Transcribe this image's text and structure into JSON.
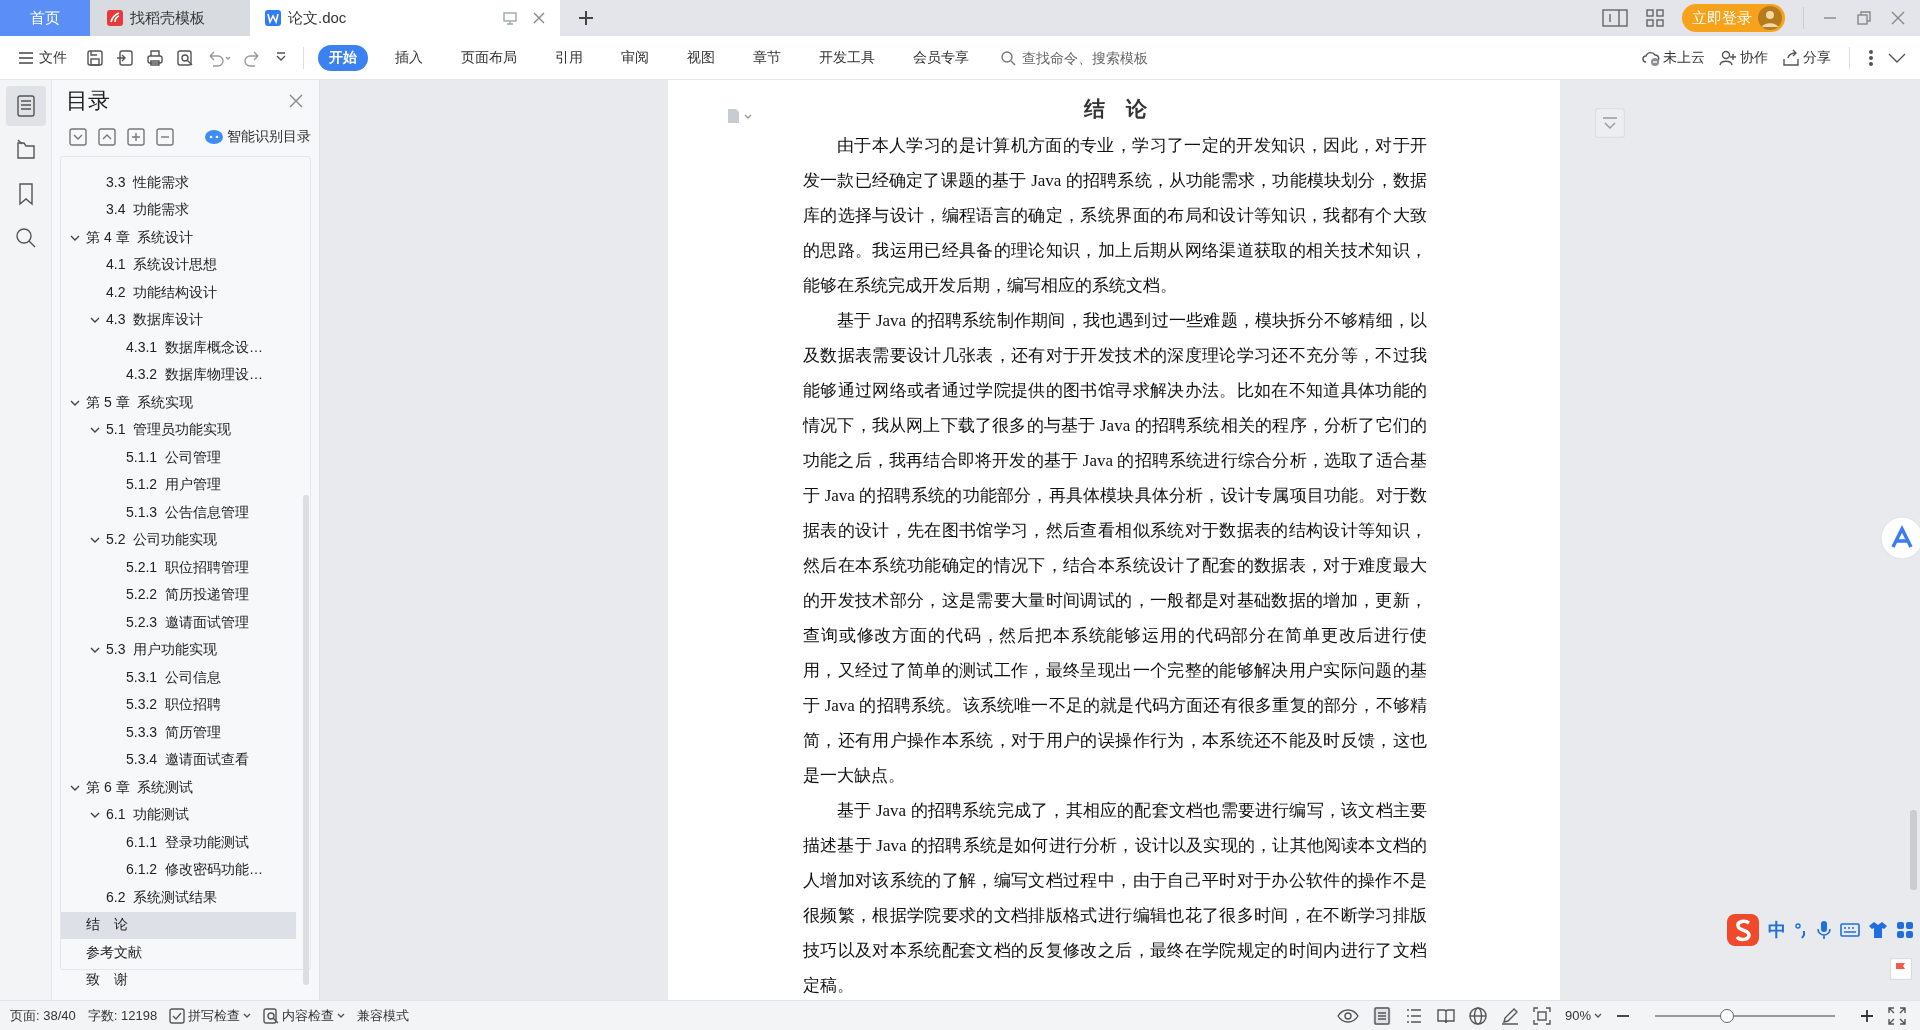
{
  "tabs": [
    {
      "label": "首页",
      "kind": "home",
      "selected": false
    },
    {
      "label": "找稻壳模板",
      "kind": "template",
      "selected": false
    },
    {
      "label": "论文.doc",
      "kind": "document",
      "selected": true
    }
  ],
  "account": {
    "login_button": "立即登录"
  },
  "menu": {
    "file": "文件"
  },
  "ribbon_tabs": [
    {
      "label": "开始",
      "selected": true
    },
    {
      "label": "插入",
      "selected": false
    },
    {
      "label": "页面布局",
      "selected": false
    },
    {
      "label": "引用",
      "selected": false
    },
    {
      "label": "审阅",
      "selected": false
    },
    {
      "label": "视图",
      "selected": false
    },
    {
      "label": "章节",
      "selected": false
    },
    {
      "label": "开发工具",
      "selected": false
    },
    {
      "label": "会员专享",
      "selected": false
    }
  ],
  "search": {
    "placeholder": "查找命令、搜索模板"
  },
  "right_actions": [
    {
      "label": "未上云",
      "kind": "cloud"
    },
    {
      "label": "协作",
      "kind": "share-user"
    },
    {
      "label": "分享",
      "kind": "share"
    }
  ],
  "toc": {
    "title": "目录",
    "smart_button": "智能识别目录",
    "items": [
      {
        "kind": "continuation",
        "children": [
          {
            "label": "3.3  性能需求",
            "selected": false
          },
          {
            "label": "3.4  功能需求",
            "selected": false
          }
        ]
      },
      {
        "label": "第 4 章  系统设计",
        "expanded": true,
        "selected": false,
        "children": [
          {
            "label": "4.1  系统设计思想",
            "selected": false
          },
          {
            "label": "4.2  功能结构设计",
            "selected": false
          },
          {
            "label": "4.3  数据库设计",
            "expanded": true,
            "selected": false,
            "children": [
              {
                "label": "4.3.1  数据库概念设…",
                "selected": false
              },
              {
                "label": "4.3.2  数据库物理设…",
                "selected": false
              }
            ]
          }
        ]
      },
      {
        "label": "第 5 章  系统实现",
        "expanded": true,
        "selected": false,
        "children": [
          {
            "label": "5.1  管理员功能实现",
            "expanded": true,
            "selected": false,
            "children": [
              {
                "label": "5.1.1  公司管理",
                "selected": false
              },
              {
                "label": "5.1.2  用户管理",
                "selected": false
              },
              {
                "label": "5.1.3  公告信息管理",
                "selected": false
              }
            ]
          },
          {
            "label": "5.2  公司功能实现",
            "expanded": true,
            "selected": false,
            "children": [
              {
                "label": "5.2.1  职位招聘管理",
                "selected": false
              },
              {
                "label": "5.2.2  简历投递管理",
                "selected": false
              },
              {
                "label": "5.2.3  邀请面试管理",
                "selected": false
              }
            ]
          },
          {
            "label": "5.3  用户功能实现",
            "expanded": true,
            "selected": false,
            "children": [
              {
                "label": "5.3.1  公司信息",
                "selected": false
              },
              {
                "label": "5.3.2  职位招聘",
                "selected": false
              },
              {
                "label": "5.3.3  简历管理",
                "selected": false
              },
              {
                "label": "5.3.4  邀请面试查看",
                "selected": false
              }
            ]
          }
        ]
      },
      {
        "label": "第 6 章  系统测试",
        "expanded": true,
        "selected": false,
        "children": [
          {
            "label": "6.1  功能测试",
            "expanded": true,
            "selected": false,
            "children": [
              {
                "label": "6.1.1  登录功能测试",
                "selected": false
              },
              {
                "label": "6.1.2  修改密码功能…",
                "selected": false
              }
            ]
          },
          {
            "label": "6.2  系统测试结果",
            "selected": false
          }
        ]
      },
      {
        "label": "结　论",
        "selected": true
      },
      {
        "label": "参考文献",
        "selected": false
      },
      {
        "label": "致　谢",
        "selected": false
      }
    ]
  },
  "document": {
    "heading": "结　论",
    "paragraphs": [
      "由于本人学习的是计算机方面的专业，学习了一定的开发知识，因此，对于开发一款已经确定了课题的基于 Java 的招聘系统，从功能需求，功能模块划分，数据库的选择与设计，编程语言的确定，系统界面的布局和设计等知识，我都有个大致的思路。我运用已经具备的理论知识，加上后期从网络渠道获取的相关技术知识，能够在系统完成开发后期，编写相应的系统文档。",
      "基于 Java 的招聘系统制作期间，我也遇到过一些难题，模块拆分不够精细，以及数据表需要设计几张表，还有对于开发技术的深度理论学习还不充分等，不过我能够通过网络或者通过学院提供的图书馆寻求解决办法。比如在不知道具体功能的情况下，我从网上下载了很多的与基于 Java 的招聘系统相关的程序，分析了它们的功能之后，我再结合即将开发的基于 Java 的招聘系统进行综合分析，选取了适合基于 Java 的招聘系统的功能部分，再具体模块具体分析，设计专属项目功能。对于数据表的设计，先在图书馆学习，然后查看相似系统对于数据表的结构设计等知识，然后在本系统功能确定的情况下，结合本系统设计了配套的数据表，对于难度最大的开发技术部分，这是需要大量时间调试的，一般都是对基础数据的增加，更新，查询或修改方面的代码，然后把本系统能够运用的代码部分在简单更改后进行使用，又经过了简单的测试工作，最终呈现出一个完整的能够解决用户实际问题的基于 Java 的招聘系统。该系统唯一不足的就是代码方面还有很多重复的部分，不够精简，还有用户操作本系统，对于用户的误操作行为，本系统还不能及时反馈，这也是一大缺点。",
      "基于 Java 的招聘系统完成了，其相应的配套文档也需要进行编写，该文档主要描述基于 Java 的招聘系统是如何进行分析，设计以及实现的，让其他阅读本文档的人增加对该系统的了解，编写文档过程中，由于自己平时对于办公软件的操作不是很频繁，根据学院要求的文档排版格式进行编辑也花了很多时间，在不断学习排版技巧以及对本系统配套文档的反复修改之后，最终在学院规定的时间内进行了文档定稿。"
    ]
  },
  "status_bar": {
    "page": "页面: 38/40",
    "words": "字数: 12198",
    "spell_check": "拼写检查",
    "content_check": "内容检查",
    "mode": "兼容模式",
    "zoom": "90%",
    "zoom_slider": {
      "level": 0.4
    }
  },
  "ime": {
    "label": "中"
  }
}
